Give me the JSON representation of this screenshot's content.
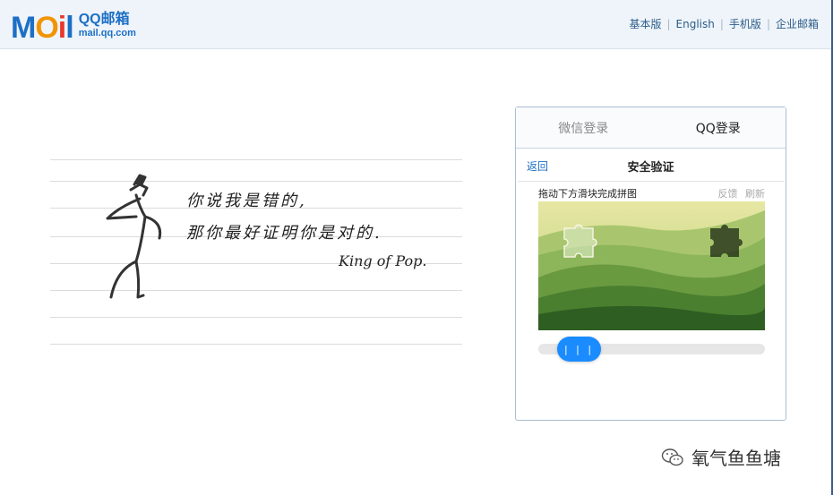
{
  "header": {
    "logo_letters": [
      "M",
      "O",
      "i",
      "l"
    ],
    "logo_title": "QQ邮箱",
    "logo_url": "mail.qq.com",
    "links": [
      "基本版",
      "English",
      "手机版",
      "企业邮箱"
    ]
  },
  "poster": {
    "line1": "你说我是错的,",
    "line2": "那你最好证明你是对的.",
    "signature": "King of Pop."
  },
  "login": {
    "tabs": [
      {
        "label": "微信登录",
        "active": false
      },
      {
        "label": "QQ登录",
        "active": true
      }
    ],
    "back_label": "返回",
    "title": "安全验证",
    "instruction": "拖动下方滑块完成拼图",
    "feedback_label": "反馈",
    "refresh_label": "刷新",
    "slider_grip": "| | |"
  },
  "watermark": {
    "icon": "wechat-icon",
    "text": "氧气鱼鱼塘"
  },
  "colors": {
    "accent": "#1a8cff",
    "link": "#1d6fc5",
    "header_bg": "#eef4fa"
  }
}
